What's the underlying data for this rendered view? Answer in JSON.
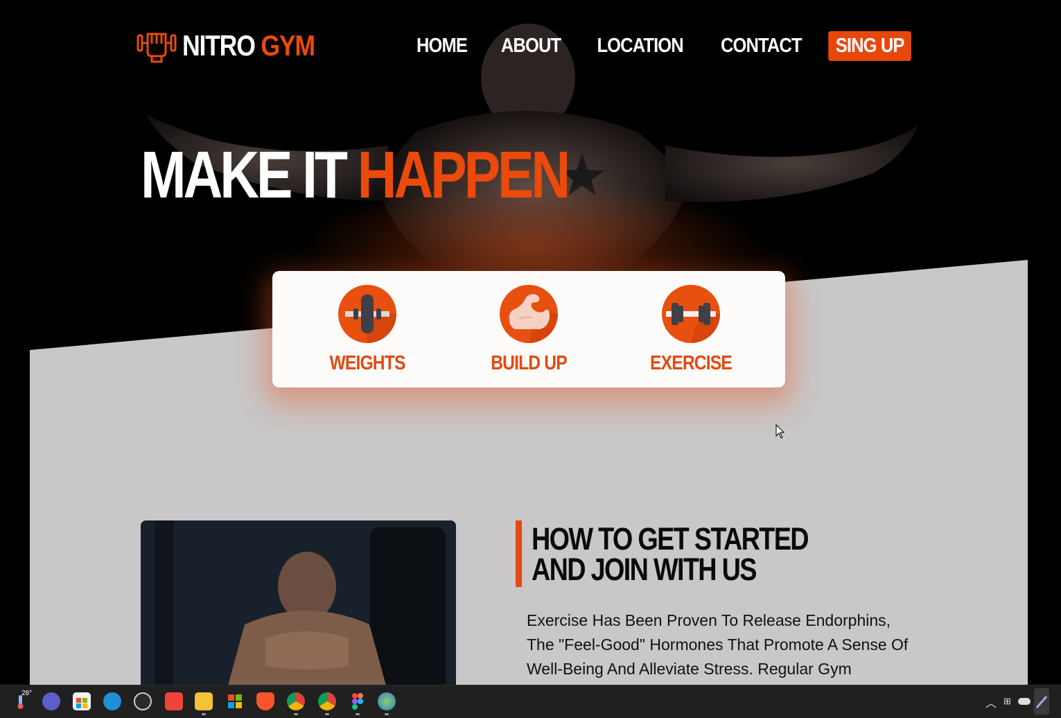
{
  "header": {
    "brand_name": "NITRO",
    "brand_accent": "GYM",
    "nav": [
      {
        "label": "HOME"
      },
      {
        "label": "ABOUT"
      },
      {
        "label": "LOCATION"
      },
      {
        "label": "CONTACT"
      }
    ],
    "signup_label": "SING UP"
  },
  "hero": {
    "title_main": "MAKE IT",
    "title_accent": "HAPPEN"
  },
  "features": [
    {
      "label": "WEIGHTS",
      "icon": "weight-plate-icon"
    },
    {
      "label": "BUILD UP",
      "icon": "flexed-arm-icon"
    },
    {
      "label": "EXERCISE",
      "icon": "dumbbell-icon"
    }
  ],
  "started": {
    "heading": "HOW TO GET STARTED AND JOIN WITH US",
    "body": "Exercise Has Been Proven To Release Endorphins, The \"Feel-Good\" Hormones That Promote A Sense Of Well-Being And Alleviate Stress. Regular Gym"
  },
  "taskbar": {
    "weather_temp": "28°",
    "apps": [
      "weather-icon",
      "meet-icon",
      "store-icon",
      "edge-icon",
      "media-player-icon",
      "anydesk-icon",
      "file-explorer-icon",
      "windows-icon",
      "brave-icon",
      "chrome-profile-icon",
      "chrome-icon",
      "figma-icon",
      "earth-icon"
    ]
  },
  "colors": {
    "accent": "#ea4a0c",
    "grey_section": "#c9c7c8",
    "card_bg": "#fdfcfb",
    "taskbar": "#202020"
  }
}
